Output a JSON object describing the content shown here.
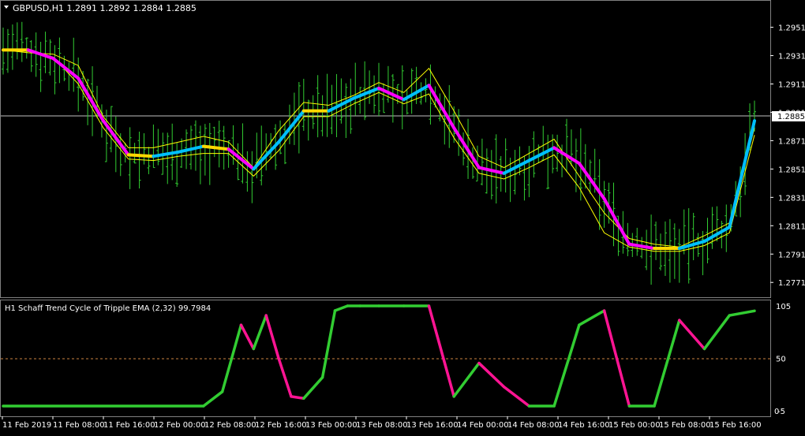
{
  "main": {
    "caption": "GBPUSD,H1  1.2891 1.2892 1.2884 1.2885",
    "price_badge": "1.2885",
    "y_ticks": [
      "1.2951",
      "1.2931",
      "1.2911",
      "1.2891",
      "1.2871",
      "1.2851",
      "1.2831",
      "1.2811",
      "1.2791",
      "1.2771"
    ]
  },
  "sub": {
    "caption": "H1 Schaff Trend Cycle of Tripple EMA (2,32) 99.7984",
    "y_ticks": [
      "105",
      "50",
      "-5"
    ],
    "y_tick_right_extra": "0"
  },
  "x_ticks": [
    "11 Feb 2019",
    "11 Feb 08:00",
    "11 Feb 16:00",
    "12 Feb 00:00",
    "12 Feb 08:00",
    "12 Feb 16:00",
    "13 Feb 00:00",
    "13 Feb 08:00",
    "13 Feb 16:00",
    "14 Feb 00:00",
    "14 Feb 08:00",
    "14 Feb 16:00",
    "15 Feb 00:00",
    "15 Feb 08:00",
    "15 Feb 16:00"
  ],
  "colors": {
    "background": "#000000",
    "bars": "#32cd32",
    "trend_up": "#00bfff",
    "trend_down": "#ff00ff",
    "trend_turn": "#ffd700",
    "envelope": "#ffff00",
    "stc_up": "#32cd32",
    "stc_down": "#ff1493",
    "level_line": "#cd853f",
    "frame": "#808080"
  },
  "chart_data": [
    {
      "type": "line",
      "title": "GBPUSD,H1",
      "ylim": [
        1.2765,
        1.2958
      ],
      "current_price": 1.2885,
      "x": [
        0,
        4,
        8,
        12,
        16,
        20,
        24,
        28,
        32,
        36,
        40,
        44,
        48,
        52,
        56,
        60,
        64,
        68,
        72,
        76,
        80,
        84,
        88,
        92,
        96,
        100,
        104,
        108,
        112,
        116,
        120
      ],
      "series": [
        {
          "values": [
            1.2935,
            1.2935,
            1.2929,
            1.2915,
            1.2885,
            1.2861,
            1.286,
            1.2863,
            1.2867,
            1.2865,
            1.2851,
            1.287,
            1.2892,
            1.2892,
            1.2901,
            1.2908,
            1.29,
            1.291,
            1.288,
            1.2852,
            1.2848,
            1.2857,
            1.2866,
            1.2855,
            1.283,
            1.2798,
            1.2795,
            1.2795,
            1.28,
            1.281,
            1.2885
          ]
        },
        {
          "values": [
            1.2935,
            1.2933,
            1.2932,
            1.2924,
            1.2888,
            1.2866,
            1.2866,
            1.287,
            1.2874,
            1.287,
            1.2852,
            1.2878,
            1.2898,
            1.2896,
            1.2903,
            1.2912,
            1.2905,
            1.2922,
            1.2892,
            1.286,
            1.2852,
            1.2862,
            1.2872,
            1.2846,
            1.282,
            1.2802,
            1.2798,
            1.2796,
            1.2804,
            1.2813,
            1.288
          ]
        },
        {
          "values": [
            1.2935,
            1.2934,
            1.293,
            1.2911,
            1.288,
            1.2858,
            1.2857,
            1.286,
            1.2862,
            1.2862,
            1.2846,
            1.2864,
            1.2888,
            1.2888,
            1.2897,
            1.2905,
            1.2897,
            1.2904,
            1.2873,
            1.2848,
            1.2844,
            1.2852,
            1.2861,
            1.2838,
            1.2806,
            1.2796,
            1.2793,
            1.2793,
            1.2797,
            1.2806,
            1.2875
          ]
        }
      ]
    },
    {
      "type": "line",
      "title": "H1 Schaff Trend Cycle of Tripple EMA (2,32) 99.7984",
      "ylim": [
        -5,
        105
      ],
      "level": 50,
      "x": [
        0,
        32,
        35,
        38,
        40,
        42,
        44,
        46,
        48,
        51,
        53,
        55,
        57,
        60,
        64,
        68,
        72,
        76,
        80,
        84,
        88,
        92,
        96,
        100,
        104,
        108,
        112,
        116,
        120
      ],
      "series": [
        {
          "values": [
            0,
            0,
            15,
            85,
            60,
            95,
            50,
            10,
            8,
            30,
            100,
            105,
            105,
            105,
            105,
            105,
            10,
            45,
            20,
            0,
            0,
            85,
            100,
            0,
            0,
            90,
            60,
            95,
            99.8
          ]
        }
      ]
    }
  ]
}
